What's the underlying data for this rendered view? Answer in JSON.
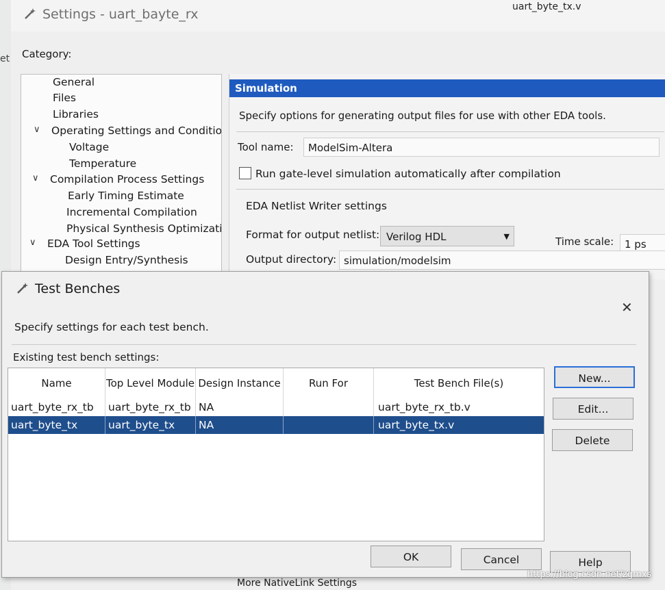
{
  "settings": {
    "title": "Settings - uart_bayte_rx",
    "top_tab": "uart_byte_tx.v",
    "left_edge_text": "et",
    "category_label": "Category:",
    "tree": [
      {
        "label": "General",
        "expandable": false
      },
      {
        "label": "Files",
        "expandable": false
      },
      {
        "label": "Libraries",
        "expandable": false
      },
      {
        "label": "Operating Settings and Conditions",
        "expandable": true
      },
      {
        "label": "Voltage",
        "expandable": false
      },
      {
        "label": "Temperature",
        "expandable": false
      },
      {
        "label": "Compilation Process Settings",
        "expandable": true
      },
      {
        "label": "Early Timing Estimate",
        "expandable": false
      },
      {
        "label": "Incremental Compilation",
        "expandable": false
      },
      {
        "label": "Physical Synthesis Optimization",
        "expandable": false
      },
      {
        "label": "EDA Tool Settings",
        "expandable": true
      },
      {
        "label": "Design Entry/Synthesis",
        "expandable": false
      }
    ],
    "simulation": {
      "header": "Simulation",
      "description": "Specify options for generating output files for use with other EDA tools.",
      "tool_name_label": "Tool name:",
      "tool_name_value": "ModelSim-Altera",
      "gate_level_label": "Run gate-level simulation automatically after compilation",
      "netlist_title": "EDA Netlist Writer settings",
      "format_label": "Format for output netlist:",
      "format_value": "Verilog HDL",
      "timescale_label": "Time scale:",
      "timescale_value": "1 ps",
      "outdir_label": "Output directory:",
      "outdir_value": "simulation/modelsim"
    },
    "bottom_text": "More NativeLink Settings"
  },
  "dialog": {
    "title": "Test Benches",
    "close": "✕",
    "description": "Specify settings for each test bench.",
    "existing_label": "Existing test bench settings:",
    "columns": [
      "Name",
      "Top Level Module",
      "Design Instance",
      "Run For",
      "Test Bench File(s)"
    ],
    "rows": [
      [
        "uart_byte_rx_tb",
        "uart_byte_rx_tb",
        "NA",
        "",
        "uart_byte_rx_tb.v"
      ],
      [
        "uart_byte_tx",
        "uart_byte_tx",
        "NA",
        "",
        "uart_byte_tx.v"
      ]
    ],
    "buttons": {
      "new": "New...",
      "edit": "Edit...",
      "delete": "Delete",
      "ok": "OK",
      "cancel": "Cancel",
      "help": "Help"
    }
  },
  "watermark": "https://blog.csdn.net/zgmxs",
  "colors": {
    "selection": "#1f4e8c",
    "header": "#1f5bbf"
  }
}
